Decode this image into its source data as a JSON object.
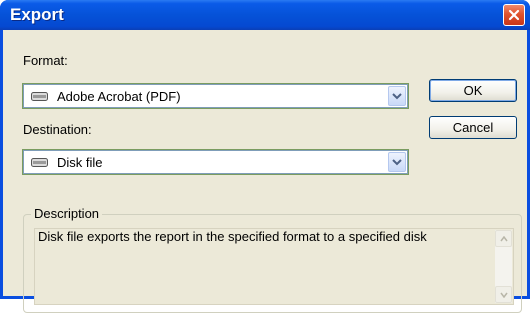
{
  "window": {
    "title": "Export"
  },
  "format": {
    "label": "Format:",
    "value": "Adobe Acrobat (PDF)"
  },
  "destination": {
    "label": "Destination:",
    "value": "Disk file"
  },
  "buttons": {
    "ok": "OK",
    "cancel": "Cancel"
  },
  "description": {
    "title": "Description",
    "text": "Disk file exports the report in the specified format to a specified disk"
  },
  "colors": {
    "titlebar": "#0552d8",
    "client": "#ece9d8",
    "close": "#e0532d"
  }
}
